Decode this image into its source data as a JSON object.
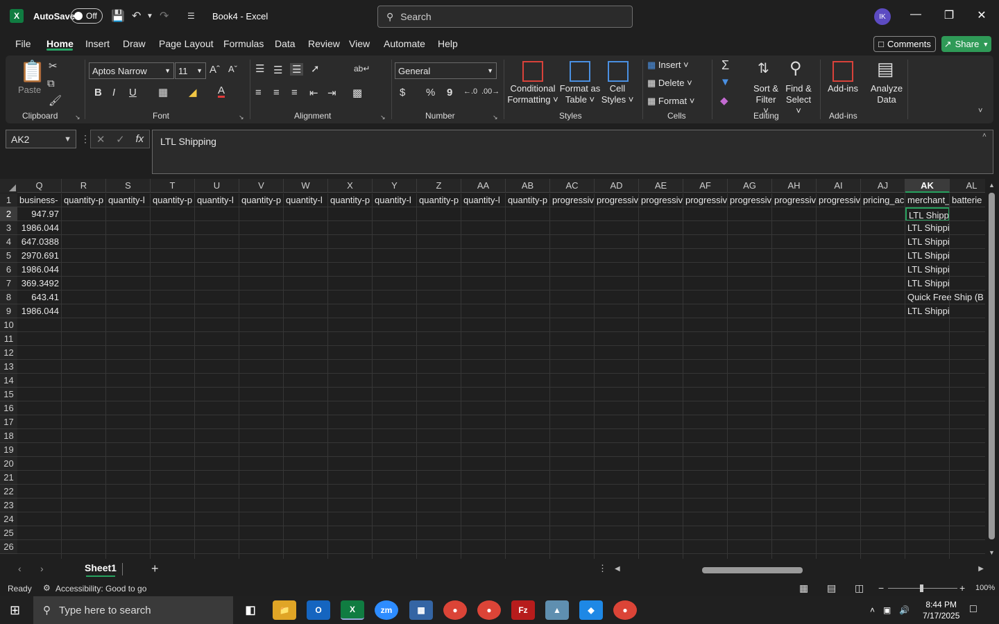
{
  "titlebar": {
    "autosave_label": "AutoSave",
    "toggle_label": "Off",
    "doc_title": "Book4  -  Excel",
    "search_placeholder": "Search",
    "avatar_initials": "IK"
  },
  "menu": {
    "items": [
      "File",
      "Home",
      "Insert",
      "Draw",
      "Page Layout",
      "Formulas",
      "Data",
      "Review",
      "View",
      "Automate",
      "Help"
    ],
    "active": "Home",
    "comments_label": "Comments",
    "share_label": "Share"
  },
  "ribbon": {
    "clipboard": {
      "paste": "Paste",
      "label": "Clipboard"
    },
    "font": {
      "family": "Aptos Narrow",
      "size": "11",
      "label": "Font",
      "bold": "B",
      "italic": "I",
      "underline": "U"
    },
    "alignment": {
      "label": "Alignment"
    },
    "number": {
      "format": "General",
      "label": "Number",
      "currency": "$",
      "percent": "%",
      "comma": "9"
    },
    "styles": {
      "conditional": "Conditional",
      "conditional2": "Formatting",
      "format_as": "Format as",
      "format_as2": "Table",
      "cell": "Cell",
      "cell2": "Styles",
      "label": "Styles"
    },
    "cells": {
      "insert": "Insert",
      "delete": "Delete",
      "format": "Format",
      "label": "Cells"
    },
    "editing": {
      "sort": "Sort &",
      "sort2": "Filter",
      "find": "Find &",
      "find2": "Select",
      "label": "Editing"
    },
    "addins": {
      "addins": "Add-ins",
      "analyze": "Analyze",
      "analyze2": "Data",
      "label": "Add-ins"
    }
  },
  "formula_bar": {
    "name_box": "AK2",
    "value": "LTL Shipping"
  },
  "grid": {
    "columns": [
      "Q",
      "R",
      "S",
      "T",
      "U",
      "V",
      "W",
      "X",
      "Y",
      "Z",
      "AA",
      "AB",
      "AC",
      "AD",
      "AE",
      "AF",
      "AG",
      "AH",
      "AI",
      "AJ",
      "AK",
      "AL"
    ],
    "selected_column": "AK",
    "rows": [
      "1",
      "2",
      "3",
      "4",
      "5",
      "6",
      "7",
      "8",
      "9",
      "10",
      "11",
      "12",
      "13",
      "14",
      "15",
      "16",
      "17",
      "18",
      "19",
      "20",
      "21",
      "22",
      "23",
      "24",
      "25",
      "26"
    ],
    "selected_row": "2",
    "headers_row1": [
      "business-",
      "quantity-p",
      "quantity-l",
      "quantity-p",
      "quantity-l",
      "quantity-p",
      "quantity-l",
      "quantity-p",
      "quantity-l",
      "quantity-p",
      "quantity-l",
      "quantity-p",
      "progressiv",
      "progressiv",
      "progressiv",
      "progressiv",
      "progressiv",
      "progressiv",
      "progressiv",
      "pricing_ac",
      "merchant_",
      "batterie"
    ],
    "col_q": [
      "947.97",
      "1986.044",
      "647.0388",
      "2970.691",
      "1986.044",
      "369.3492",
      "643.41",
      "1986.044"
    ],
    "col_ak": [
      "LTL Shipping",
      "LTL Shipping",
      "LTL Shipping",
      "LTL Shipping",
      "LTL Shipping",
      "LTL Shipping",
      "Quick Free Ship (B",
      "LTL Shipping"
    ]
  },
  "sheets": {
    "tabs": [
      "Sheet1"
    ],
    "active": "Sheet1"
  },
  "status": {
    "ready": "Ready",
    "accessibility": "Accessibility: Good to go",
    "zoom": "100%"
  },
  "taskbar": {
    "search_placeholder": "Type here to search",
    "time": "8:44 PM",
    "date": "7/17/2025"
  },
  "colors": {
    "accent": "#27a35f",
    "share": "#2f9a57",
    "excel": "#107c41"
  }
}
